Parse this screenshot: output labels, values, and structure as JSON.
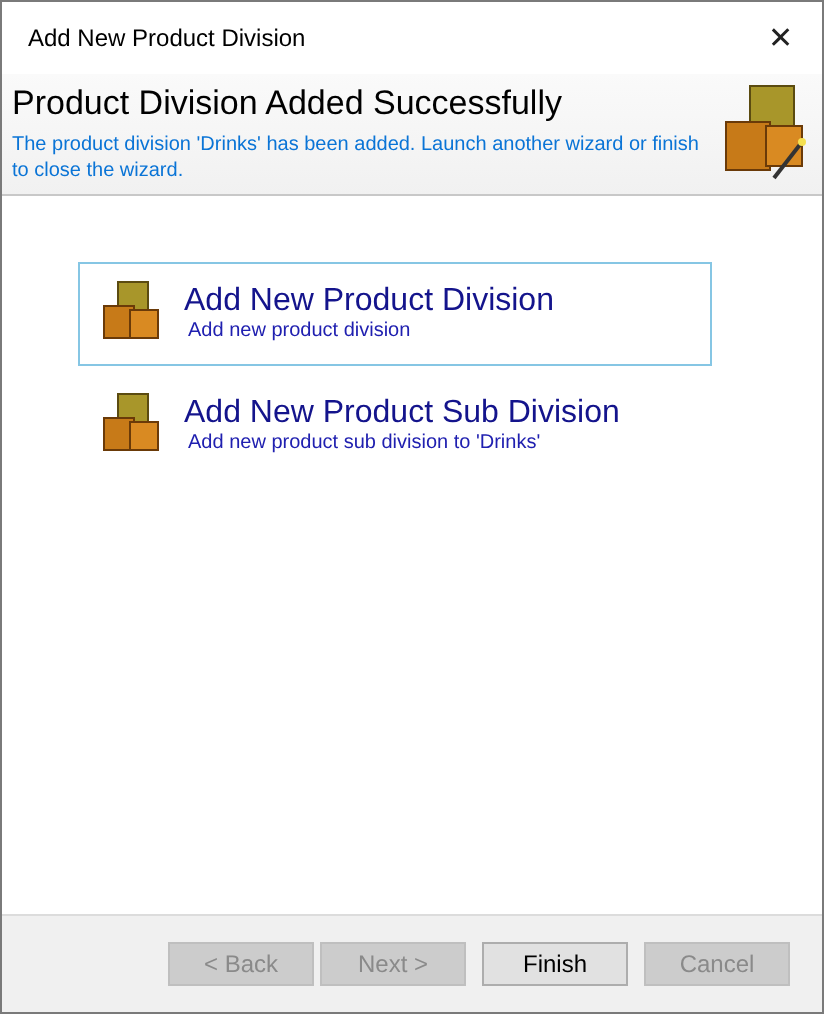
{
  "window": {
    "title": "Add New Product Division",
    "close": "✕"
  },
  "header": {
    "title": "Product Division Added Successfully",
    "description": "The product division 'Drinks' has been added.  Launch another wizard or finish to close the wizard."
  },
  "tasks": [
    {
      "title": "Add New Product Division",
      "subtitle": "Add new product division",
      "selected": true
    },
    {
      "title": "Add New Product Sub Division",
      "subtitle": "Add new product sub division to 'Drinks'",
      "selected": false
    }
  ],
  "buttons": [
    {
      "label": "< Back",
      "disabled": true
    },
    {
      "label": "Next >",
      "disabled": true
    },
    {
      "label": "Finish",
      "disabled": false
    },
    {
      "label": "Cancel",
      "disabled": true
    }
  ]
}
